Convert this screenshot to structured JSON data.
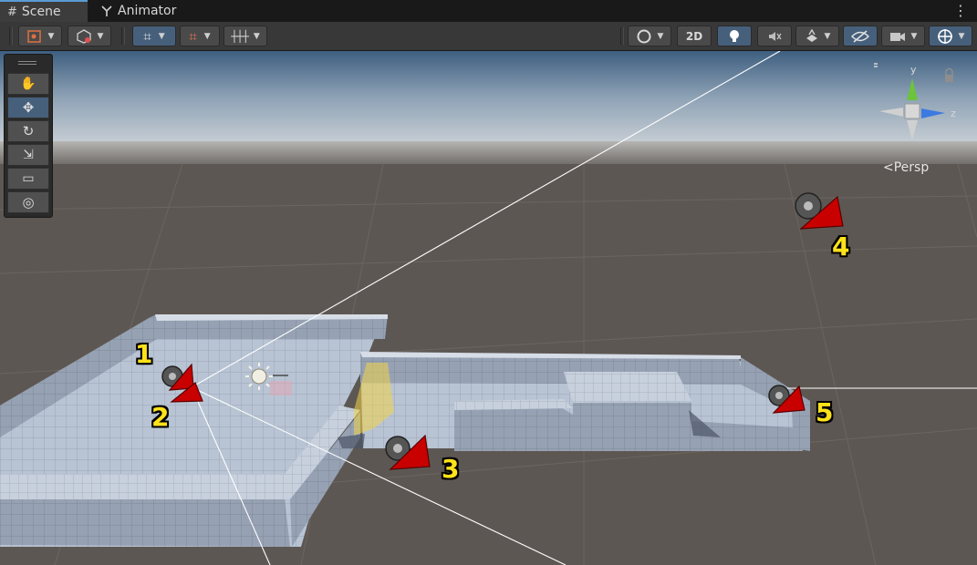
{
  "tabs": [
    {
      "label": "Scene",
      "icon": "grid-icon",
      "active": true
    },
    {
      "label": "Animator",
      "icon": "animator-icon",
      "active": false
    }
  ],
  "toolbar": {
    "gizmo_toggle": "tool-handle-icon",
    "draw_mode": "shading-mode-icon",
    "grid_snapping": "grid-snap-icon",
    "increment_snap": "increment-snap-icon",
    "render_mode": "render-mode-icon",
    "mode_2d_label": "2D",
    "lighting": "lightbulb-icon",
    "audio": "audio-mute-icon",
    "effects": "effects-icon",
    "visibility": "hidden-eye-icon",
    "camera": "camera-icon",
    "gizmos": "gizmos-icon"
  },
  "tools": [
    {
      "name": "hand-tool",
      "icon": "hand-icon",
      "active": false
    },
    {
      "name": "move-tool",
      "icon": "move-icon",
      "active": true
    },
    {
      "name": "rotate-tool",
      "icon": "rotate-icon",
      "active": false
    },
    {
      "name": "scale-tool",
      "icon": "scale-icon",
      "active": false
    },
    {
      "name": "rect-tool",
      "icon": "rect-icon",
      "active": false
    },
    {
      "name": "transform-tool",
      "icon": "transform-icon",
      "active": false
    }
  ],
  "gizmo": {
    "y_label": "y",
    "z_label": "z",
    "projection_label": "<Persp"
  },
  "markers": [
    "1",
    "2",
    "3",
    "4",
    "5"
  ],
  "colors": {
    "accent": "#46607c",
    "marker": "#ffe21a",
    "camera_icon": "#c80000"
  }
}
